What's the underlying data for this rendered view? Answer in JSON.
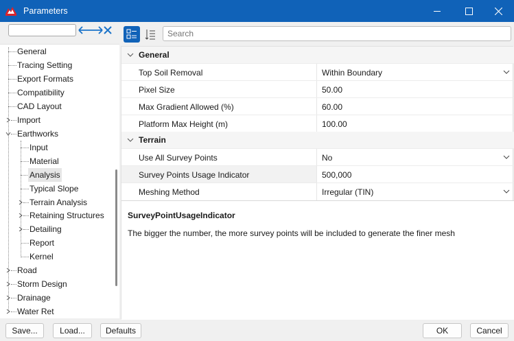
{
  "window": {
    "title": "Parameters"
  },
  "left_panel": {
    "search_value": ""
  },
  "tree": {
    "items": [
      {
        "label": "General"
      },
      {
        "label": "Tracing Setting"
      },
      {
        "label": "Export Formats"
      },
      {
        "label": "Compatibility"
      },
      {
        "label": "CAD Layout"
      },
      {
        "label": "Import"
      },
      {
        "label": "Earthworks"
      },
      {
        "label": "Input"
      },
      {
        "label": "Material"
      },
      {
        "label": "Analysis"
      },
      {
        "label": "Typical Slope"
      },
      {
        "label": "Terrain Analysis"
      },
      {
        "label": "Retaining Structures"
      },
      {
        "label": "Detailing"
      },
      {
        "label": "Report"
      },
      {
        "label": "Kernel"
      },
      {
        "label": "Road"
      },
      {
        "label": "Storm Design"
      },
      {
        "label": "Drainage"
      },
      {
        "label": "Water Ret"
      }
    ],
    "selected": "Analysis"
  },
  "toolbar": {
    "search_placeholder": "Search"
  },
  "grid": {
    "categories": [
      {
        "name": "General",
        "rows": [
          {
            "name": "Top Soil Removal",
            "value": "Within Boundary",
            "dropdown": true
          },
          {
            "name": "Pixel Size",
            "value": "50.00"
          },
          {
            "name": "Max Gradient Allowed (%)",
            "value": "60.00"
          },
          {
            "name": "Platform Max Height (m)",
            "value": "100.00"
          }
        ]
      },
      {
        "name": "Terrain",
        "rows": [
          {
            "name": "Use All Survey Points",
            "value": "No",
            "dropdown": true
          },
          {
            "name": "Survey Points Usage Indicator",
            "value": "500,000"
          },
          {
            "name": "Meshing Method",
            "value": "Irregular (TIN)",
            "dropdown": true
          }
        ]
      }
    ]
  },
  "description": {
    "title": "SurveyPointUsageIndicator",
    "text": "The bigger the number, the more survey points will be included to generate the finer mesh"
  },
  "buttons": {
    "save": "Save...",
    "load": "Load...",
    "defaults": "Defaults",
    "ok": "OK",
    "cancel": "Cancel"
  },
  "colors": {
    "titlebar": "#1062b8",
    "accent": "#1062b8"
  }
}
